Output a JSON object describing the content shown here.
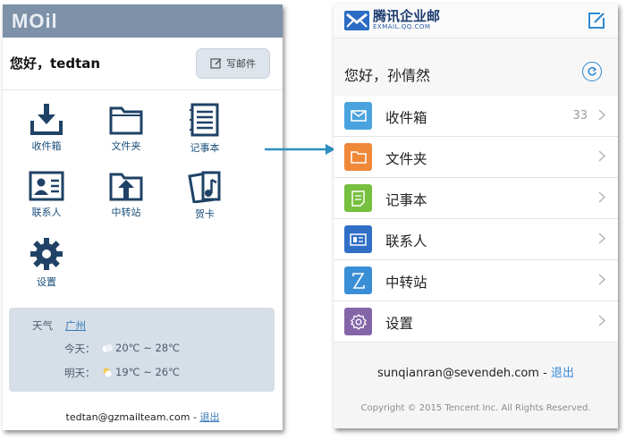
{
  "left_app": {
    "logo": "MOil",
    "greeting": "您好，tedtan",
    "compose_label": "写邮件",
    "grid": [
      {
        "label": "收件箱",
        "icon": "inbox-download-icon"
      },
      {
        "label": "文件夹",
        "icon": "folder-icon"
      },
      {
        "label": "记事本",
        "icon": "notebook-icon"
      },
      {
        "label": "联系人",
        "icon": "contact-card-icon"
      },
      {
        "label": "中转站",
        "icon": "transfer-folder-icon"
      },
      {
        "label": "贺卡",
        "icon": "music-card-icon"
      },
      {
        "label": "设置",
        "icon": "gear-icon"
      }
    ],
    "weather": {
      "label": "天气",
      "city": "广州",
      "today_label": "今天：",
      "today_range": "20℃ ~ 28℃",
      "tomorrow_label": "明天：",
      "tomorrow_range": "19℃ ~ 26℃"
    },
    "footer": {
      "email": "tedtan@gzmailteam.com",
      "separator": " - ",
      "logout": "退出"
    }
  },
  "right_app": {
    "brand_cn": "腾讯企业邮",
    "brand_en": "EXMAIL.QQ.COM",
    "greeting": "您好，孙倩然",
    "list": [
      {
        "label": "收件箱",
        "count": "33",
        "icon": "envelope-icon",
        "color": "#4aa3df"
      },
      {
        "label": "文件夹",
        "count": "",
        "icon": "folder-icon",
        "color": "#f0883a"
      },
      {
        "label": "记事本",
        "count": "",
        "icon": "note-icon",
        "color": "#77bf3e"
      },
      {
        "label": "联系人",
        "count": "",
        "icon": "contact-card-icon",
        "color": "#2f6fc6"
      },
      {
        "label": "中转站",
        "count": "",
        "icon": "transfer-icon",
        "color": "#3a8ed6"
      },
      {
        "label": "设置",
        "count": "",
        "icon": "gear-icon",
        "color": "#8466a8"
      }
    ],
    "account": {
      "email": "sunqianran@sevendeh.com",
      "separator": " - ",
      "logout": "退出"
    },
    "copyright": "Copyright © 2015 Tencent Inc. All Rights Reserved."
  },
  "colors": {
    "left_topbar": "#7d91a8",
    "left_icon": "#1f4266",
    "link_blue": "#3478b5",
    "arrow": "#2d8fc1"
  }
}
